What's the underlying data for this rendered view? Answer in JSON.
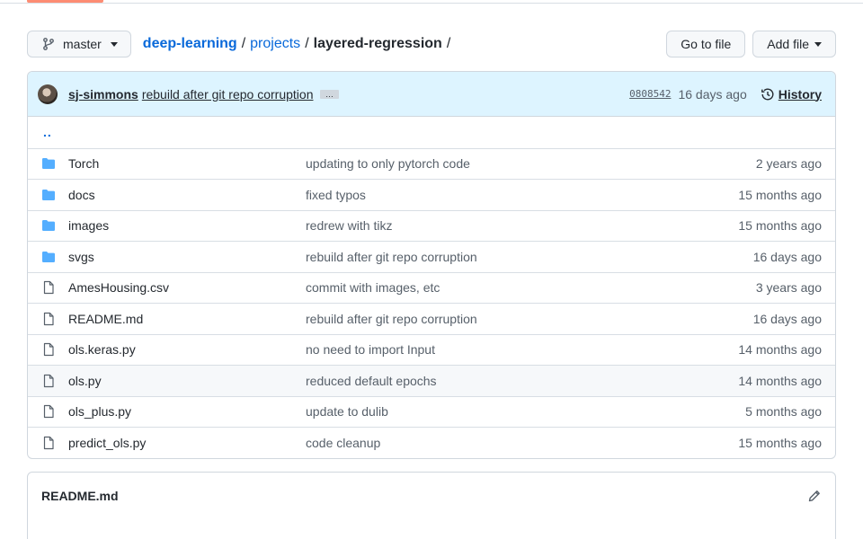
{
  "branch": {
    "label": "master"
  },
  "breadcrumb": {
    "repo": "deep-learning",
    "sep1": "/",
    "dir": "projects",
    "sep2": "/",
    "current": "layered-regression",
    "sep3": "/"
  },
  "actions": {
    "go_to_file": "Go to file",
    "add_file": "Add file"
  },
  "commit": {
    "author": "sj-simmons",
    "message": "rebuild after git repo corruption",
    "ellipsis": "…",
    "sha": "0808542",
    "age": "16 days ago",
    "history": "History"
  },
  "updir": "..",
  "files": [
    {
      "type": "dir",
      "name": "Torch",
      "message": "updating to only pytorch code",
      "age": "2 years ago"
    },
    {
      "type": "dir",
      "name": "docs",
      "message": "fixed typos",
      "age": "15 months ago"
    },
    {
      "type": "dir",
      "name": "images",
      "message": "redrew with tikz",
      "age": "15 months ago"
    },
    {
      "type": "dir",
      "name": "svgs",
      "message": "rebuild after git repo corruption",
      "age": "16 days ago"
    },
    {
      "type": "file",
      "name": "AmesHousing.csv",
      "message": "commit with images, etc",
      "age": "3 years ago"
    },
    {
      "type": "file",
      "name": "README.md",
      "message": "rebuild after git repo corruption",
      "age": "16 days ago"
    },
    {
      "type": "file",
      "name": "ols.keras.py",
      "message": "no need to import Input",
      "age": "14 months ago"
    },
    {
      "type": "file",
      "name": "ols.py",
      "message": "reduced default epochs",
      "age": "14 months ago"
    },
    {
      "type": "file",
      "name": "ols_plus.py",
      "message": "update to dulib",
      "age": "5 months ago"
    },
    {
      "type": "file",
      "name": "predict_ols.py",
      "message": "code cleanup",
      "age": "15 months ago"
    }
  ],
  "readme": {
    "title": "README.md"
  },
  "colors": {
    "link": "#0969da",
    "folder": "#54aeff",
    "accent": "#fd8c73",
    "commit_bg": "#ddf4ff"
  }
}
